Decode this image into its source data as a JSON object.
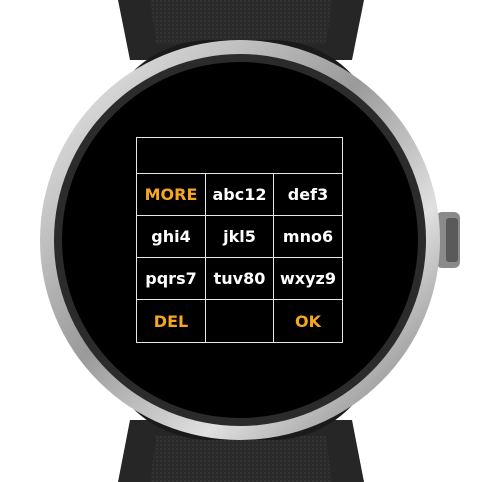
{
  "colors": {
    "accent": "#f5a623",
    "text": "#ffffff",
    "screen": "#000000",
    "grid": "#e6e6e6"
  },
  "keypad": {
    "display_text": "",
    "keys": [
      [
        "MORE",
        "abc12",
        "def3"
      ],
      [
        "ghi4",
        "jkl5",
        "mno6"
      ],
      [
        "pqrs7",
        "tuv80",
        "wxyz9"
      ],
      [
        "DEL",
        "",
        "OK"
      ]
    ]
  }
}
